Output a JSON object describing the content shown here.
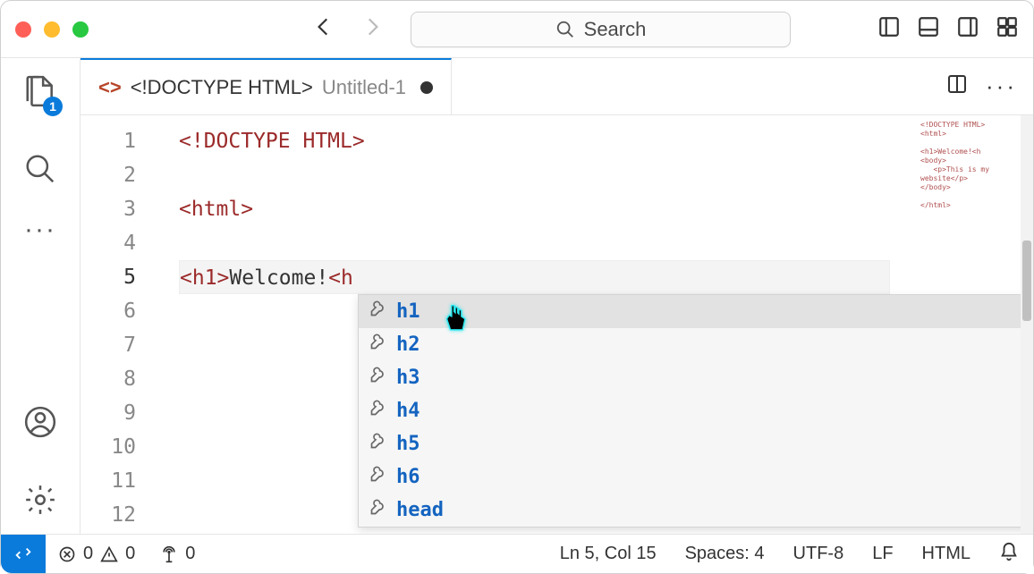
{
  "titlebar": {
    "search_placeholder": "Search"
  },
  "activity": {
    "explorer_badge": "1"
  },
  "tab": {
    "doctype_label": "<!DOCTYPE HTML>",
    "filename": "Untitled-1"
  },
  "editor": {
    "lines": [
      {
        "num": "1",
        "tag": "<!DOCTYPE HTML>",
        "text": ""
      },
      {
        "num": "2",
        "tag": "",
        "text": ""
      },
      {
        "num": "3",
        "tag": "<html>",
        "text": ""
      },
      {
        "num": "4",
        "tag": "",
        "text": ""
      },
      {
        "num": "5",
        "tag_open": "<h1>",
        "content": "Welcome!",
        "tag_partial": "<h",
        "current": true
      },
      {
        "num": "6",
        "tag": "",
        "text": ""
      },
      {
        "num": "7",
        "tag": "",
        "text": ""
      },
      {
        "num": "8",
        "tag": "",
        "text": ""
      },
      {
        "num": "9",
        "tag": "",
        "text": ""
      },
      {
        "num": "10",
        "tag": "",
        "text": ""
      },
      {
        "num": "11",
        "tag": "",
        "text": ""
      },
      {
        "num": "12",
        "tag": "",
        "text": ""
      }
    ]
  },
  "suggestions": {
    "items": [
      {
        "match": "h",
        "rest": "1",
        "selected": true
      },
      {
        "match": "h",
        "rest": "2"
      },
      {
        "match": "h",
        "rest": "3"
      },
      {
        "match": "h",
        "rest": "4"
      },
      {
        "match": "h",
        "rest": "5"
      },
      {
        "match": "h",
        "rest": "6"
      },
      {
        "match": "h",
        "rest": "ead"
      }
    ]
  },
  "status": {
    "errors": "0",
    "warnings": "0",
    "ports": "0",
    "cursor": "Ln 5, Col 15",
    "spaces": "Spaces: 4",
    "encoding": "UTF-8",
    "eol": "LF",
    "language": "HTML"
  }
}
